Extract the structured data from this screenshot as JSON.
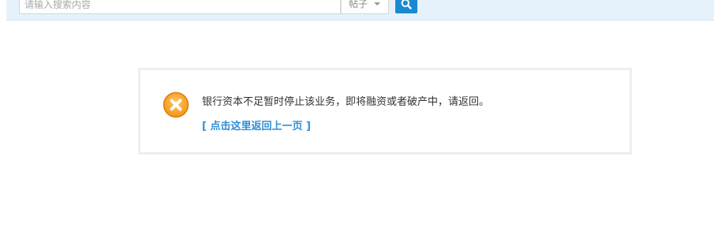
{
  "search": {
    "placeholder": "请输入搜索内容",
    "value": "",
    "type_selected": "帖子",
    "button_icon": "search-icon"
  },
  "message": {
    "icon": "error-x-icon",
    "icon_color": "#f59a23",
    "text": "银行资本不足暂时停止该业务，即将融资或者破产中，请返回。",
    "back_link": "[ 点击这里返回上一页 ]",
    "link_color": "#2f8fd8"
  },
  "colors": {
    "topbar_bg": "#e6f2fb",
    "search_button": "#1a8ad0"
  }
}
